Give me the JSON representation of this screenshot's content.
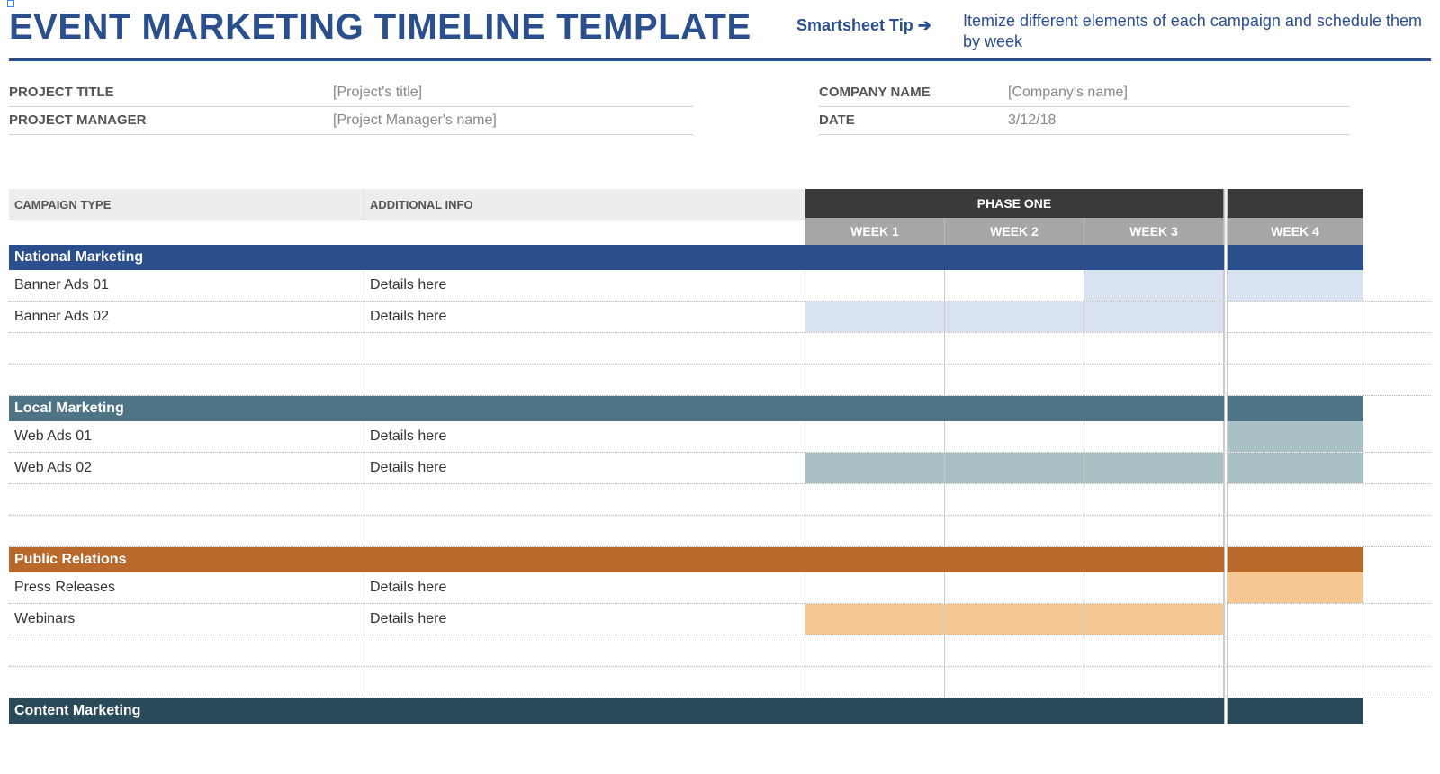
{
  "header": {
    "title": "EVENT MARKETING TIMELINE TEMPLATE",
    "tip_label": "Smartsheet Tip",
    "tip_arrow": "➔",
    "description": "Itemize different elements of each campaign and schedule them by week"
  },
  "meta": {
    "left": [
      {
        "label": "PROJECT TITLE",
        "value": "[Project's title]"
      },
      {
        "label": "PROJECT MANAGER",
        "value": "[Project Manager's name]"
      }
    ],
    "right": [
      {
        "label": "COMPANY NAME",
        "value": "[Company's name]"
      },
      {
        "label": "DATE",
        "value": "3/12/18"
      }
    ]
  },
  "columns": {
    "campaign_type": "CAMPAIGN TYPE",
    "additional_info": "ADDITIONAL INFO",
    "phase_label": "PHASE ONE",
    "weeks": [
      "WEEK 1",
      "WEEK 2",
      "WEEK 3",
      "WEEK 4"
    ]
  },
  "sections": [
    {
      "name": "National Marketing",
      "color_class": "c-navy",
      "rows": [
        {
          "campaign": "Banner Ads 01",
          "info": "Details here",
          "fill_class": "f-blue",
          "weeks": [
            false,
            false,
            true,
            true
          ]
        },
        {
          "campaign": "Banner Ads 02",
          "info": "Details here",
          "fill_class": "f-blue",
          "weeks": [
            true,
            true,
            true,
            false
          ]
        },
        {
          "campaign": "",
          "info": "",
          "fill_class": "",
          "weeks": [
            false,
            false,
            false,
            false
          ]
        },
        {
          "campaign": "",
          "info": "",
          "fill_class": "",
          "weeks": [
            false,
            false,
            false,
            false
          ]
        }
      ]
    },
    {
      "name": "Local Marketing",
      "color_class": "c-steel",
      "rows": [
        {
          "campaign": "Web Ads 01",
          "info": "Details here",
          "fill_class": "f-steel",
          "weeks": [
            false,
            false,
            false,
            true
          ]
        },
        {
          "campaign": "Web Ads 02",
          "info": "Details here",
          "fill_class": "f-steel",
          "weeks": [
            true,
            true,
            true,
            true
          ]
        },
        {
          "campaign": "",
          "info": "",
          "fill_class": "",
          "weeks": [
            false,
            false,
            false,
            false
          ]
        },
        {
          "campaign": "",
          "info": "",
          "fill_class": "",
          "weeks": [
            false,
            false,
            false,
            false
          ]
        }
      ]
    },
    {
      "name": "Public Relations",
      "color_class": "c-rust",
      "rows": [
        {
          "campaign": "Press Releases",
          "info": "Details here",
          "fill_class": "f-orange",
          "weeks": [
            false,
            false,
            false,
            true
          ]
        },
        {
          "campaign": "Webinars",
          "info": "Details here",
          "fill_class": "f-orange",
          "weeks": [
            true,
            true,
            true,
            false
          ]
        },
        {
          "campaign": "",
          "info": "",
          "fill_class": "",
          "weeks": [
            false,
            false,
            false,
            false
          ]
        },
        {
          "campaign": "",
          "info": "",
          "fill_class": "",
          "weeks": [
            false,
            false,
            false,
            false
          ]
        }
      ]
    },
    {
      "name": "Content Marketing",
      "color_class": "c-teal",
      "rows": []
    }
  ]
}
